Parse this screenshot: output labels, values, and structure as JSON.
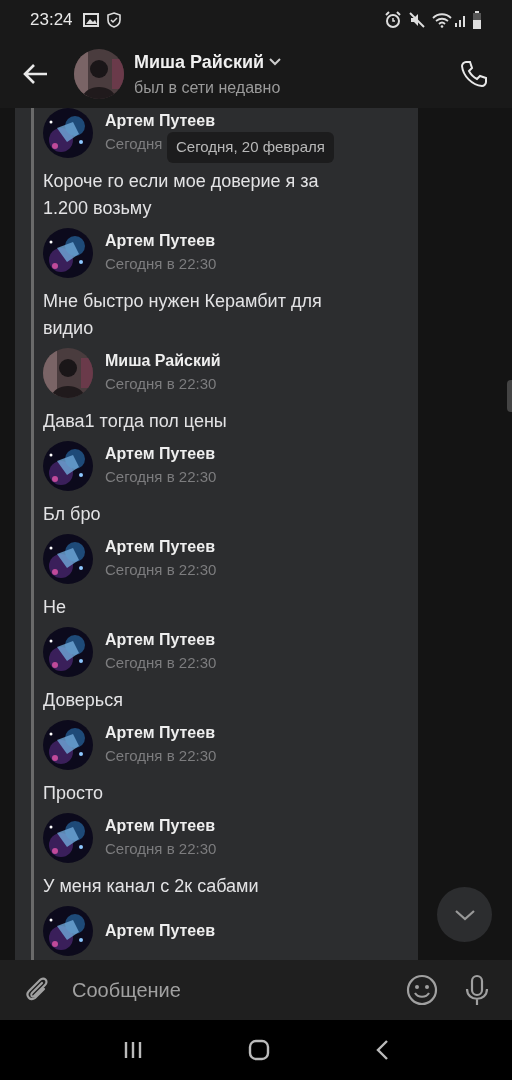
{
  "status_bar": {
    "time": "23:24"
  },
  "header": {
    "title": "Миша Райский",
    "subtitle": "был в сети недавно"
  },
  "date_pill": "Сегодня, 20 февраля",
  "messages": [
    {
      "author": "Артем Путеев",
      "kind": "galaxy",
      "time": "Сегодня",
      "text": "Короче го если мое доверие я за 1.200 возьму"
    },
    {
      "author": "Артем Путеев",
      "kind": "galaxy",
      "time": "Сегодня в 22:30",
      "text": "Мне быстро нужен Керамбит для видио"
    },
    {
      "author": "Миша Райский",
      "kind": "person",
      "time": "Сегодня в 22:30",
      "text": "Дава1 тогда пол цены"
    },
    {
      "author": "Артем Путеев",
      "kind": "galaxy",
      "time": "Сегодня в 22:30",
      "text": "Бл бро"
    },
    {
      "author": "Артем Путеев",
      "kind": "galaxy",
      "time": "Сегодня в 22:30",
      "text": "Не"
    },
    {
      "author": "Артем Путеев",
      "kind": "galaxy",
      "time": "Сегодня в 22:30",
      "text": "Доверься"
    },
    {
      "author": "Артем Путеев",
      "kind": "galaxy",
      "time": "Сегодня в 22:30",
      "text": "Просто"
    },
    {
      "author": "Артем Путеев",
      "kind": "galaxy",
      "time": "Сегодня в 22:30",
      "text": "У меня канал с 2к сабами"
    },
    {
      "author": "Артем Путеев",
      "kind": "galaxy"
    }
  ],
  "composer": {
    "placeholder": "Сообщение"
  }
}
